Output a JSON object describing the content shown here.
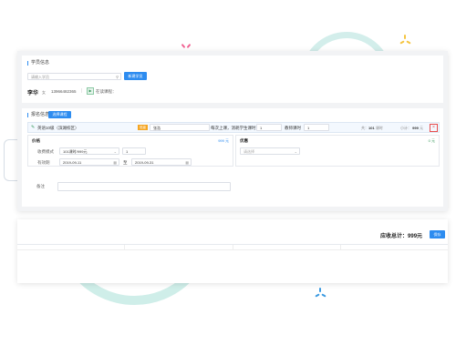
{
  "student": {
    "section_title": "学员信息",
    "search_placeholder": "请输入学员",
    "new_student_button": "新建学员",
    "name": "李华",
    "gender": "女",
    "phone": "13966482365",
    "course_status": "在读课程："
  },
  "enroll": {
    "section_title": "报名信息",
    "select_course_button": "选择课程",
    "course_name": "英语10级（滨湖校区）",
    "badge": "班级",
    "class_value": "张浩",
    "per_class_label": "每次上课，消耗学生课时",
    "per_class_value": "1",
    "teacher_hours_label": "教师课时",
    "teacher_hours_value": "1",
    "total_prefix": "共：",
    "total_count": "101",
    "total_unit": "课时",
    "subtotal_label": "小计：",
    "subtotal_value": "999",
    "subtotal_unit": "元",
    "price": {
      "title": "价格",
      "amount": "999",
      "unit": "元",
      "mode_label": "收费模式",
      "mode_value": "101课时/999元",
      "qty_value": "1",
      "validity_label": "有效期",
      "start_date": "2019-09-11",
      "to_label": "至",
      "end_date": "2019-09-31"
    },
    "discount": {
      "title": "优惠",
      "amount": "0",
      "unit": "元",
      "placeholder": "请选择"
    },
    "remark_label": "备注"
  },
  "summary": {
    "label": "应收总计：",
    "amount": "999元",
    "button": "保存"
  },
  "colors": {
    "accent": "#2d8cf0",
    "badge": "#f5a623",
    "danger": "#e84d4d",
    "ring": "#cfeee9"
  }
}
